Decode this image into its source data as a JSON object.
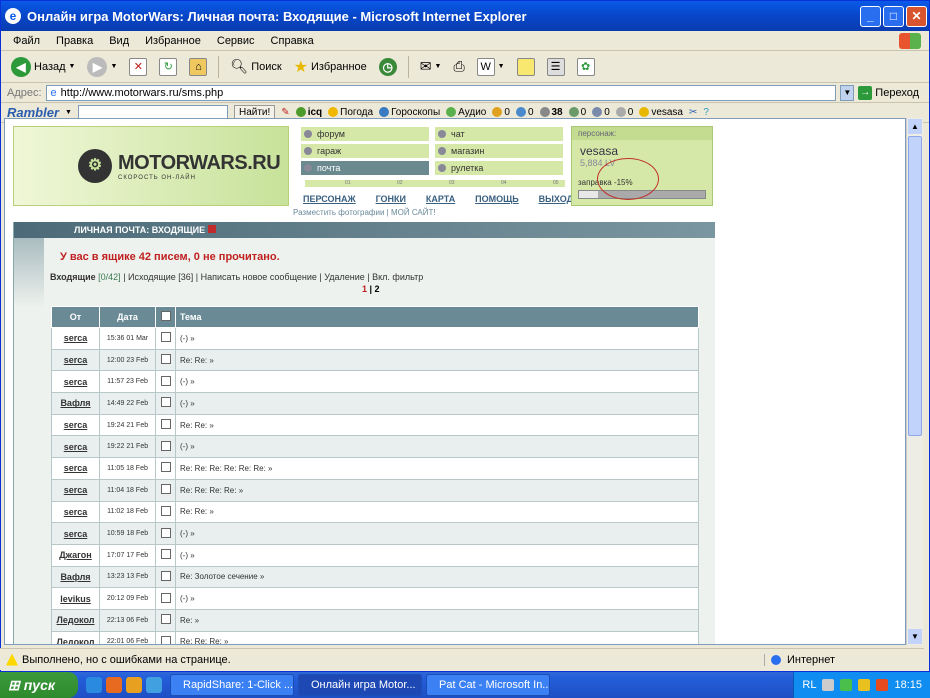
{
  "window": {
    "title": "Онлайн игра MotorWars: Личная почта: Входящие - Microsoft Internet Explorer"
  },
  "menu": [
    "Файл",
    "Правка",
    "Вид",
    "Избранное",
    "Сервис",
    "Справка"
  ],
  "toolbar": {
    "back": "Назад",
    "search": "Поиск",
    "favorites": "Избранное"
  },
  "address": {
    "label": "Адрес:",
    "url": "http://www.motorwars.ru/sms.php",
    "go": "Переход"
  },
  "rambler": {
    "logo": "Rambler",
    "find": "Найти!",
    "icq": "icq",
    "weather": "Погода",
    "horoscope": "Гороскопы",
    "audio": "Аудио",
    "c1": "0",
    "c2": "0",
    "c3": "38",
    "c4": "0",
    "c5": "0",
    "c6": "0",
    "user": "vesasa"
  },
  "site": {
    "logo": "MOTORWARS.RU",
    "tagline": "СКОРОСТЬ ОН-ЛАЙН",
    "nav": {
      "forum": "форум",
      "chat": "чат",
      "garage": "гараж",
      "shop": "магазин",
      "mail": "почта",
      "roulette": "рулетка"
    },
    "ruler": [
      "01",
      "02",
      "03",
      "04",
      "05"
    ],
    "links": [
      "ПЕРСОНАЖ",
      "ГОНКИ",
      "КАРТА",
      "ПОМОЩЬ",
      "ВЫХОД"
    ],
    "sublinks": "Разместить фотографии | МОЙ САЙТ!",
    "char": {
      "label": "персонаж:",
      "name": "vesasa",
      "money": "5,884 LV",
      "fuel": "заправка -15%",
      "fuel_level": 0.15
    }
  },
  "mail": {
    "header": "ЛИЧНАЯ ПОЧТА: ВХОДЯЩИЕ",
    "info": "У вас в ящике 42 писем, 0 не прочитано.",
    "inbox": "Входящие",
    "inbox_count": "[0/42]",
    "outbox": "Исходящие [36]",
    "compose": "Написать новое сообщение",
    "delete": "Удаление",
    "filter": "Вкл. фильтр",
    "page1": "1",
    "page2": "2",
    "cols": {
      "from": "От",
      "date": "Дата",
      "subject": "Тема"
    },
    "rows": [
      {
        "from": "serca",
        "date": "15:36 01 Mar",
        "subject": "(-) »"
      },
      {
        "from": "serca",
        "date": "12:00 23 Feb",
        "subject": "Re: Re: »"
      },
      {
        "from": "serca",
        "date": "11:57 23 Feb",
        "subject": "(-) »"
      },
      {
        "from": "Вафля",
        "date": "14:49 22 Feb",
        "subject": "(-) »"
      },
      {
        "from": "serca",
        "date": "19:24 21 Feb",
        "subject": "Re: Re: »"
      },
      {
        "from": "serca",
        "date": "19:22 21 Feb",
        "subject": "(-) »"
      },
      {
        "from": "serca",
        "date": "11:05 18 Feb",
        "subject": "Re: Re: Re: Re: Re: Re: »"
      },
      {
        "from": "serca",
        "date": "11:04 18 Feb",
        "subject": "Re: Re: Re: Re: »"
      },
      {
        "from": "serca",
        "date": "11:02 18 Feb",
        "subject": "Re: Re: »"
      },
      {
        "from": "serca",
        "date": "10:59 18 Feb",
        "subject": "(-) »"
      },
      {
        "from": "Джагон",
        "date": "17:07 17 Feb",
        "subject": "(-) »"
      },
      {
        "from": "Вафля",
        "date": "13:23 13 Feb",
        "subject": "Re: Золотое сечение »"
      },
      {
        "from": "levikus",
        "date": "20:12 09 Feb",
        "subject": "(-) »"
      },
      {
        "from": "Ледокол",
        "date": "22:13 06 Feb",
        "subject": "Re: »"
      },
      {
        "from": "Ледокол",
        "date": "22:01 06 Feb",
        "subject": "Re: Re: Re: »"
      }
    ]
  },
  "status": {
    "msg": "Выполнено, но с ошибками на странице.",
    "zone": "Интернет"
  },
  "taskbar": {
    "start": "пуск",
    "tasks": [
      "RapidShare: 1-Click ...",
      "Онлайн игра Motor...",
      "Pat Cat - Microsoft In..."
    ],
    "lang": "RL",
    "time": "18:15"
  }
}
